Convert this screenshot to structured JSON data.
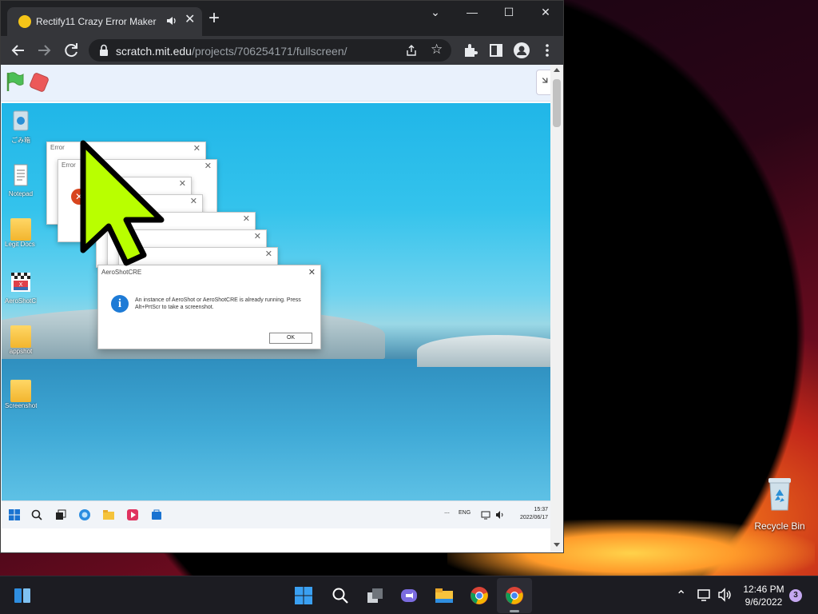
{
  "browser": {
    "tab_title": "Rectify11 Crazy Error Maker",
    "tab_close": "✕",
    "new_tab": "+",
    "url_host": "scratch.mit.edu",
    "url_path": "/projects/706254171/fullscreen/",
    "window_controls": {
      "collapse": "⌄",
      "minimize": "—",
      "maximize": "☐",
      "close": "✕"
    }
  },
  "stage": {
    "desktop_icons": [
      {
        "label": "ごみ箱",
        "icon": "recycle-bin-icon"
      },
      {
        "label": "Notepad",
        "icon": "notepad-icon"
      },
      {
        "label": "Legit Docs - I...",
        "icon": "folder-icon"
      },
      {
        "label": "AeroShotCRE",
        "icon": "aeroshot-icon"
      },
      {
        "label": "appshot",
        "icon": "folder-icon"
      },
      {
        "label": "Screenshots",
        "icon": "folder-icon"
      }
    ],
    "error_windows": [
      {
        "title": "Error"
      },
      {
        "title": "Error"
      }
    ],
    "dialog": {
      "title": "AeroShotCRE",
      "message": "An instance of AeroShot or AeroShotCRE is already running. Press Alt+PrtScr to take a screenshot.",
      "ok_label": "OK"
    },
    "taskbar": {
      "language": "ENG",
      "time": "15:37",
      "date": "2022/06/17"
    }
  },
  "desktop": {
    "recycle_bin_label": "Recycle Bin"
  },
  "taskbar": {
    "time": "12:46 PM",
    "date": "9/6/2022",
    "notification_count": "3"
  },
  "colors": {
    "accent_green": "#b9ff00",
    "chrome_dark": "#202124",
    "scratch_bar": "#e9f1fc",
    "info_blue": "#1e7bd6",
    "error_red": "#d8451e"
  }
}
